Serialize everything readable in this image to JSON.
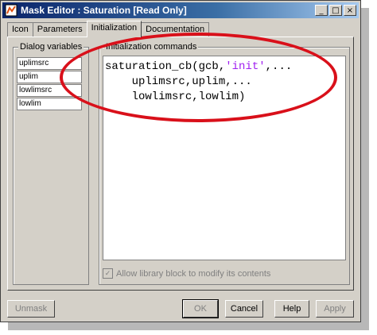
{
  "window": {
    "title": "Mask Editor : Saturation [Read Only]"
  },
  "titlebar_buttons": {
    "minimize": "_",
    "maximize": "□",
    "close": "×"
  },
  "tabs": [
    {
      "label": "Icon"
    },
    {
      "label": "Parameters"
    },
    {
      "label": "Initialization"
    },
    {
      "label": "Documentation"
    }
  ],
  "dialog_variables": {
    "label": "Dialog variables",
    "items": [
      "uplimsrc",
      "uplim",
      "lowlimsrc",
      "lowlim"
    ]
  },
  "init_commands": {
    "label": "Initialization commands",
    "lines": [
      {
        "a": "saturation_cb(gcb,",
        "str": "'init'",
        "b": ",..."
      },
      {
        "a": "    uplimsrc,uplim,...",
        "str": "",
        "b": ""
      },
      {
        "a": "    lowlimsrc,lowlim)",
        "str": "",
        "b": ""
      }
    ]
  },
  "library_checkbox": {
    "label": "Allow library block to modify its contents",
    "checked": true
  },
  "buttons": {
    "unmask": "Unmask",
    "ok": "OK",
    "cancel": "Cancel",
    "help": "Help",
    "apply": "Apply"
  },
  "colors": {
    "titlebar": "#0a246a",
    "annotation_oval": "#d9101a",
    "string_literal": "#a020f0"
  }
}
